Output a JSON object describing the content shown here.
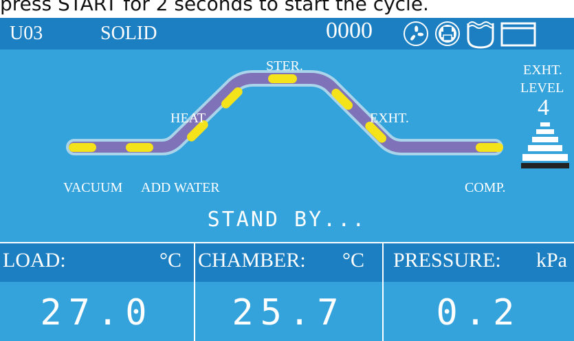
{
  "caption": "press START for 2 seconds to start the cycle.",
  "topbar": {
    "program_code": "U03",
    "program_name": "SOLID",
    "counter": "0000",
    "icons": [
      "fan-icon",
      "printer-icon",
      "water-tank-icon",
      "door-icon"
    ]
  },
  "process": {
    "stages": {
      "vacuum": "VACUUM",
      "add_water": "ADD WATER",
      "heat": "HEAT",
      "ster": "STER.",
      "exht": "EXHT.",
      "comp": "COMP."
    },
    "exhaust_level": {
      "label_line1": "EXHT.",
      "label_line2": "LEVEL",
      "value": "4"
    }
  },
  "status": "STAND BY...",
  "readings": {
    "load": {
      "label": "LOAD:",
      "unit": "°C",
      "value": "27.0"
    },
    "chamber": {
      "label": "CHAMBER:",
      "unit": "°C",
      "value": "25.7"
    },
    "pressure": {
      "label": "PRESSURE:",
      "unit": "kPa",
      "value": "0.2"
    }
  },
  "colors": {
    "screen_bg": "#34a3dc",
    "header_bg": "#1c7fc2",
    "track": "#7f72b8",
    "indicator": "#f4e21a"
  }
}
